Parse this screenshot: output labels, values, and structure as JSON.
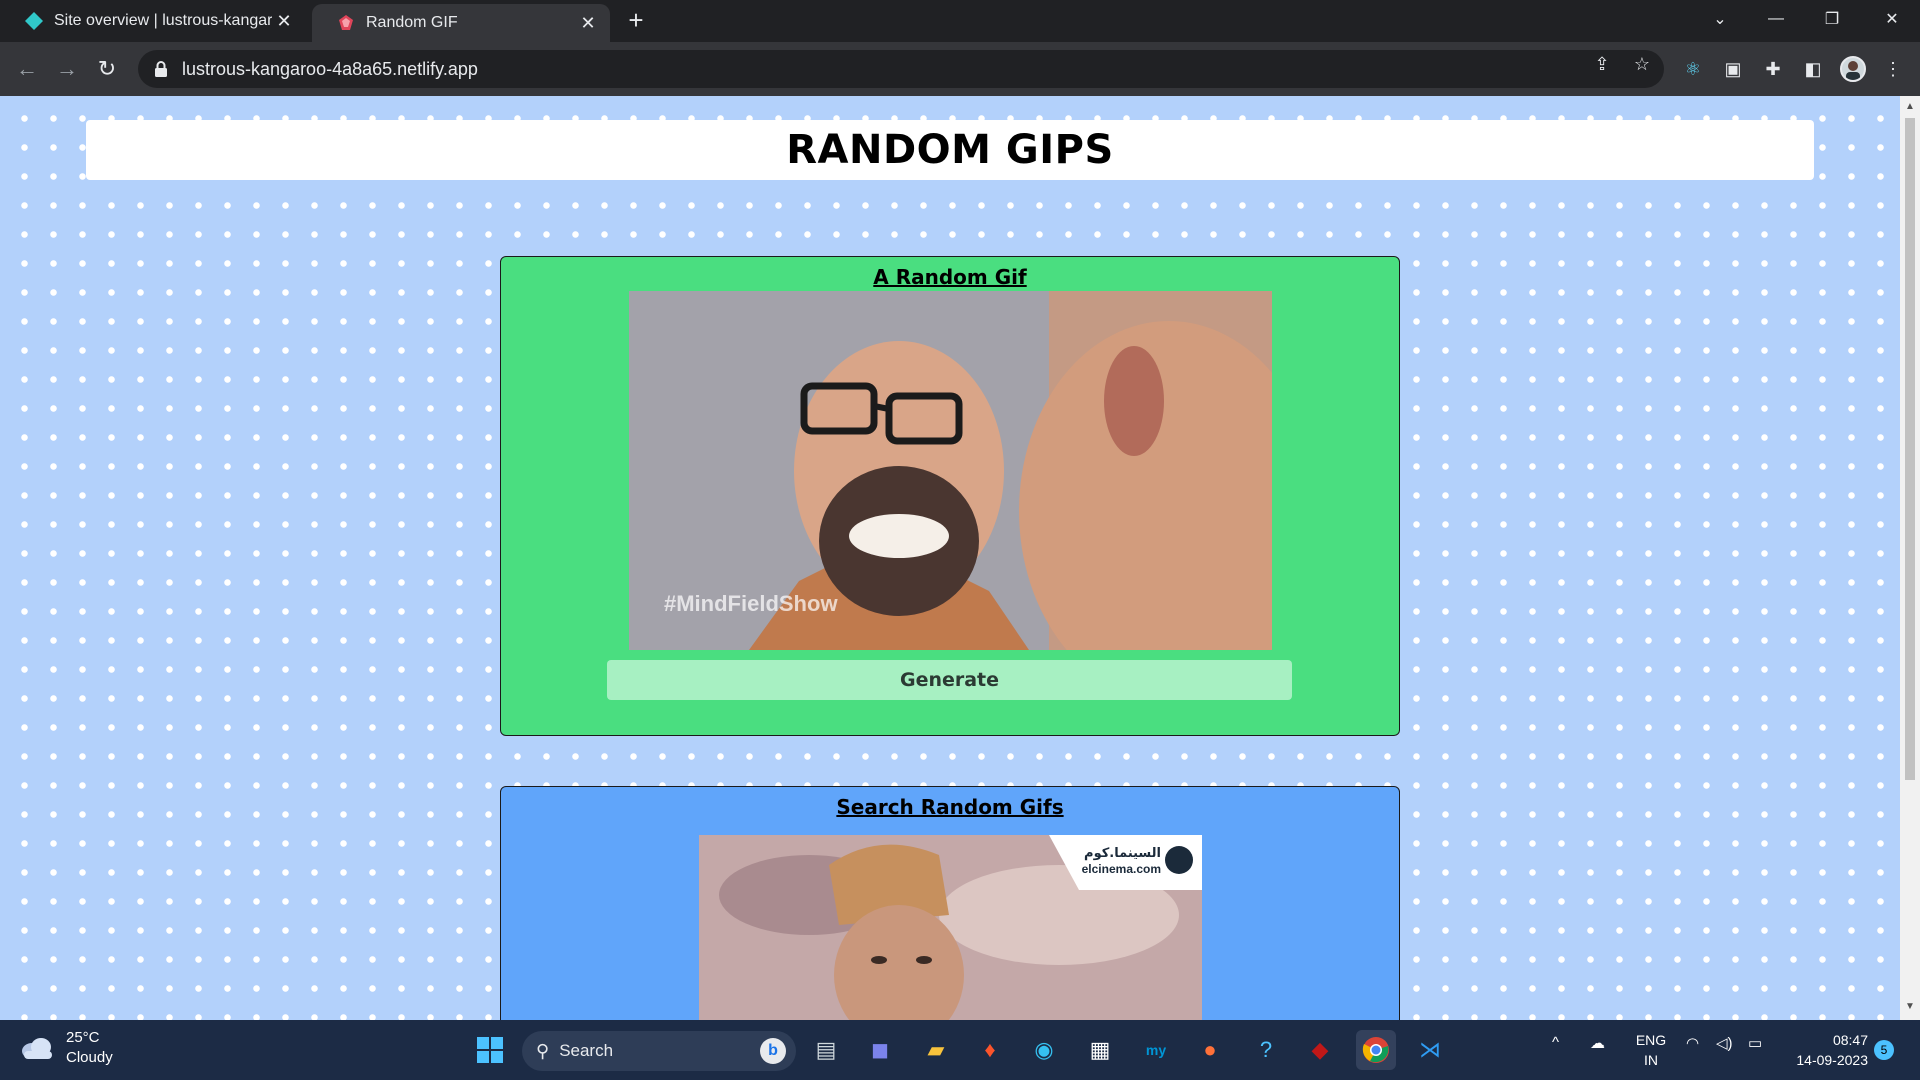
{
  "browser": {
    "tabs": [
      {
        "title": "Site overview | lustrous-kangaroo",
        "favicon": "netlify-diamond-icon",
        "active": false
      },
      {
        "title": "Random GIF",
        "favicon": "react-gem-icon",
        "active": true
      }
    ],
    "url": "lustrous-kangaroo-4a8a65.netlify.app"
  },
  "page": {
    "heading": "RANDOM GIPS",
    "random_card": {
      "title": "A Random Gif",
      "gif_watermark": "#MindFieldShow",
      "button_label": "Generate"
    },
    "search_card": {
      "title": "Search Random Gifs",
      "gif_logo_arabic": "السينما.كوم",
      "gif_logo_text": "elcinema.com"
    },
    "colors": {
      "page_bg": "#b3d1fb",
      "random_card_bg": "#4ade80",
      "search_card_bg": "#60a5fa",
      "generate_button_bg": "#a7f0c2"
    }
  },
  "taskbar": {
    "weather_temp": "25°C",
    "weather_desc": "Cloudy",
    "search_placeholder": "Search",
    "language": "ENG",
    "region": "IN",
    "time": "08:47",
    "date": "14-09-2023",
    "notification_count": "5"
  }
}
